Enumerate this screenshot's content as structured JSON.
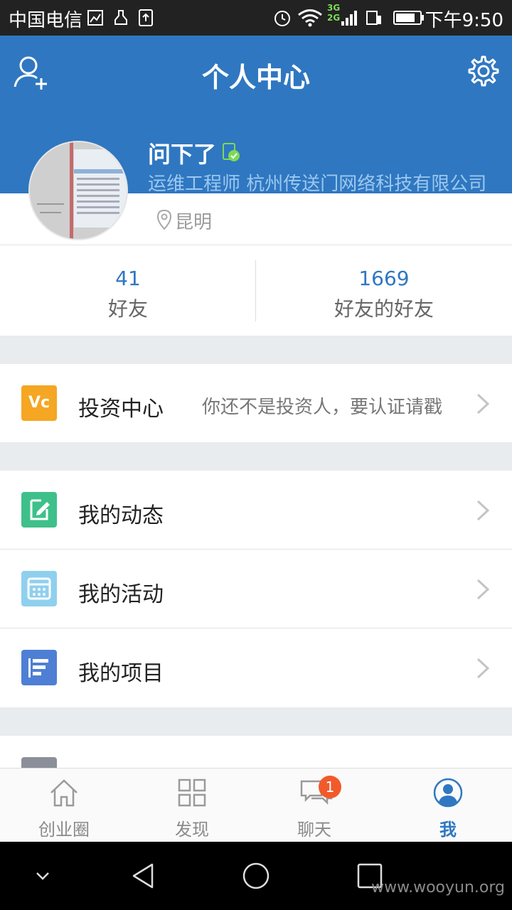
{
  "status_bar": {
    "carrier": "中国电信",
    "time": "下午9:50",
    "network_labels": [
      "3G",
      "2G"
    ]
  },
  "header": {
    "title": "个人中心",
    "icons": [
      "add-user-icon",
      "settings-gear-icon"
    ]
  },
  "profile": {
    "name": "问下了",
    "company": "运维工程师 杭州传送门网络科技有限公司",
    "location": "昆明"
  },
  "stats": [
    {
      "count": "41",
      "label": "好友"
    },
    {
      "count": "1669",
      "label": "好友的好友"
    }
  ],
  "menu": {
    "invest": {
      "label": "投资中心",
      "sub": "你还不是投资人，要认证请戳",
      "icon_text": "Vc"
    },
    "items": [
      {
        "label": "我的动态",
        "icon": "edit-note-icon"
      },
      {
        "label": "我的活动",
        "icon": "calendar-icon"
      },
      {
        "label": "我的项目",
        "icon": "project-list-icon"
      }
    ]
  },
  "bottom_nav": {
    "tabs": [
      {
        "label": "创业圈",
        "icon": "home-icon"
      },
      {
        "label": "发现",
        "icon": "grid-icon"
      },
      {
        "label": "聊天",
        "icon": "chat-icon",
        "badge": "1"
      },
      {
        "label": "我",
        "icon": "user-circle-icon",
        "active": true
      }
    ]
  },
  "watermark": "www.wooyun.org",
  "colors": {
    "header_blue": "#2f77c1",
    "active_tab": "#2f77c1",
    "badge": "#f15a2b",
    "invest_icon": "#f5a623",
    "edit_icon": "#3ec08a",
    "calendar_icon": "#8fd0ee",
    "project_icon": "#4e7fd5"
  }
}
